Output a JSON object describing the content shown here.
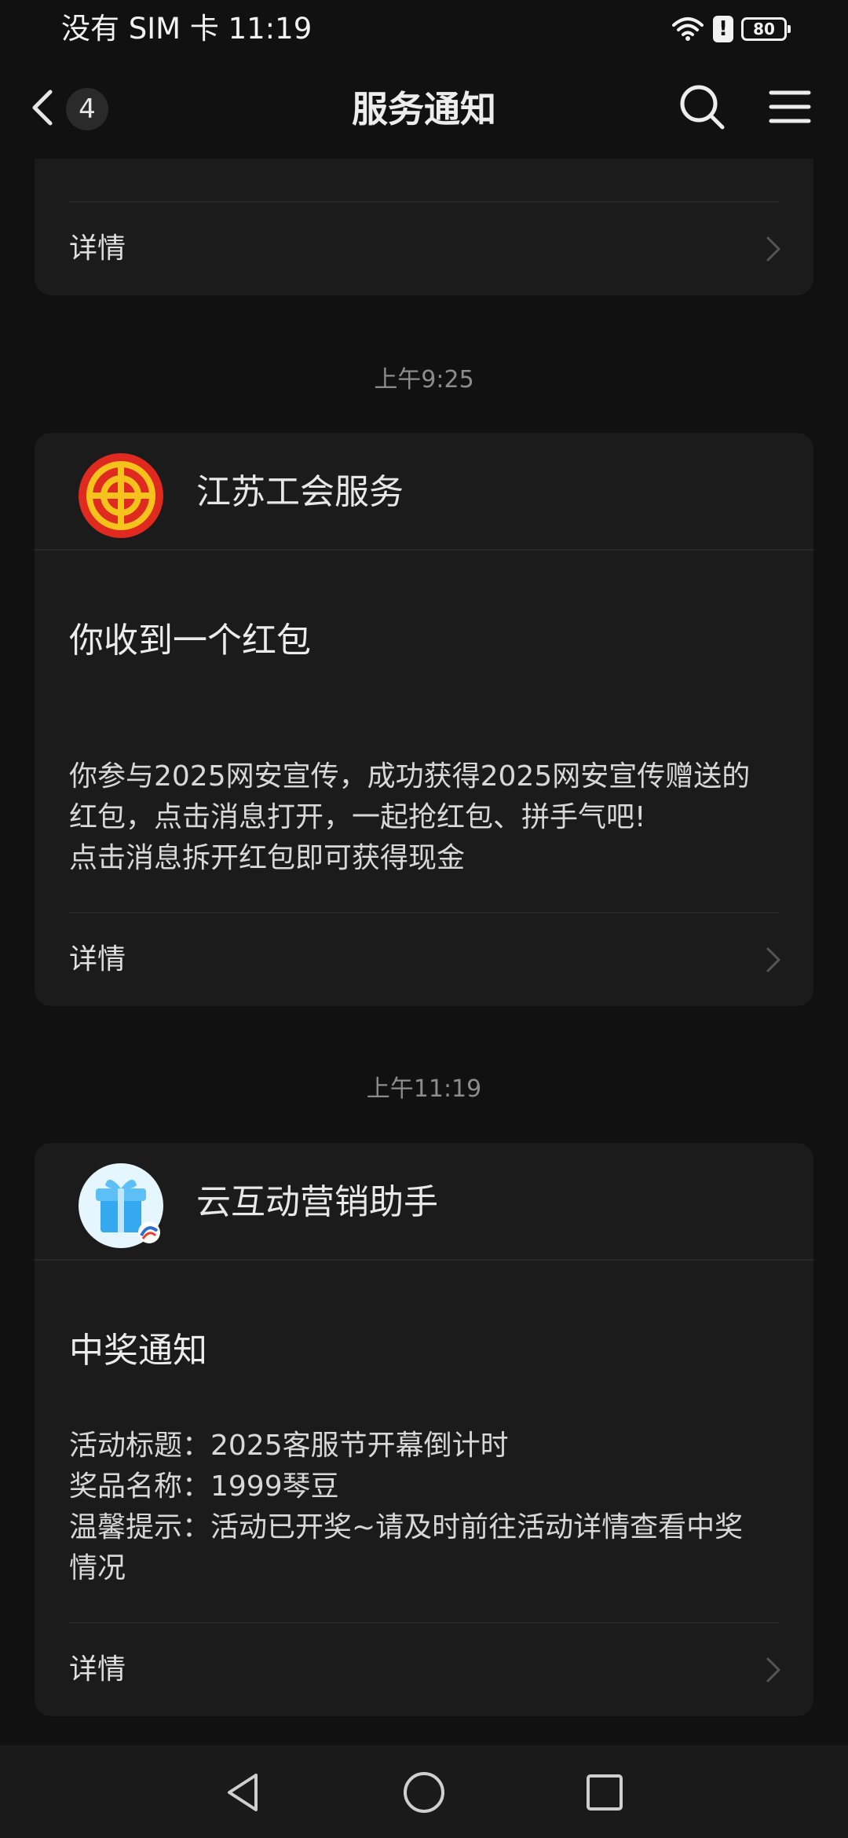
{
  "status_bar": {
    "carrier_time": "没有 SIM 卡 11:19",
    "alert_mark": "!",
    "battery_level": "80",
    "icons": [
      "wifi-icon",
      "alert-icon",
      "battery-icon"
    ]
  },
  "nav": {
    "title": "服务通知",
    "unread_count": "4",
    "icons": [
      "back-chevron-icon",
      "search-icon",
      "menu-icon"
    ]
  },
  "messages": [
    {
      "detail_label": "详情"
    },
    {
      "timestamp": "上午9:25",
      "sender": "江苏工会服务",
      "avatar_icon": "trade-union-emblem-icon",
      "title": "你收到一个红包",
      "body_lines": [
        "你参与2025网安宣传，成功获得2025网安宣传赠送的",
        "红包，点击消息打开，一起抢红包、拼手气吧!",
        "点击消息拆开红包即可获得现金"
      ],
      "detail_label": "详情"
    },
    {
      "timestamp": "上午11:19",
      "sender": "云互动营销助手",
      "avatar_icon": "gift-box-icon",
      "title": "中奖通知",
      "body_lines": [
        "活动标题：2025客服节开幕倒计时",
        "奖品名称：1999琴豆",
        "温馨提示：活动已开奖~请及时前往活动详情查看中奖",
        "情况"
      ],
      "detail_label": "详情"
    }
  ],
  "colors": {
    "background": "#111111",
    "card": "#1b1b1b",
    "emblem_red": "#e02a1f",
    "emblem_gold": "#f6c21c",
    "gift_blue": "#35a9f0"
  },
  "system_nav": {
    "icons": [
      "back-triangle-icon",
      "home-circle-icon",
      "recents-square-icon"
    ]
  }
}
